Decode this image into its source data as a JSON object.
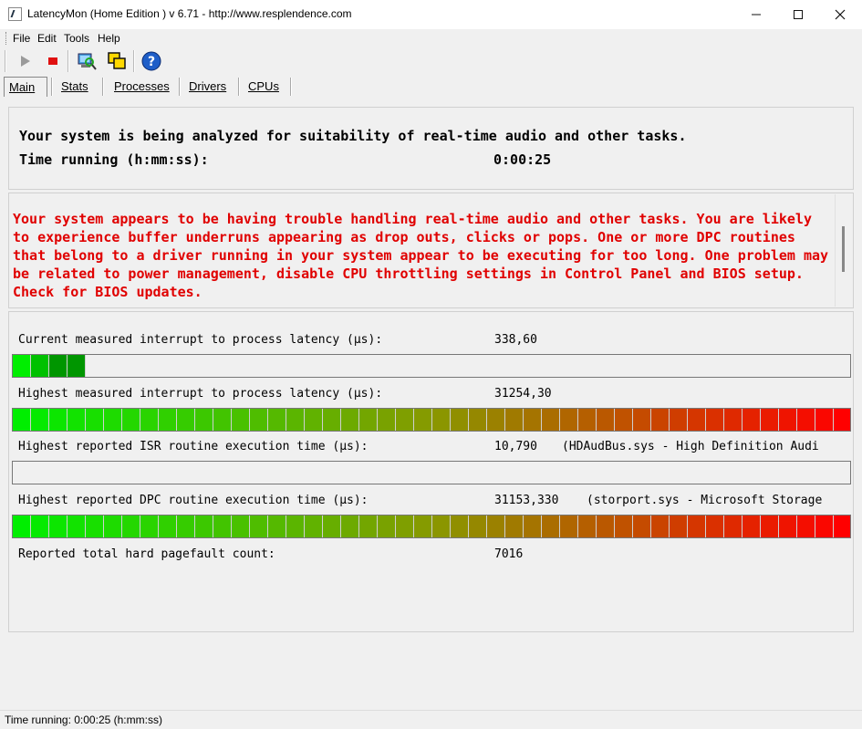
{
  "window": {
    "title": "LatencyMon  (Home Edition )  v 6.71 - http://www.resplendence.com",
    "minimize_icon": "minimize-icon",
    "maximize_icon": "maximize-icon",
    "close_icon": "close-icon"
  },
  "menu": [
    "File",
    "Edit",
    "Tools",
    "Help"
  ],
  "toolbar": {
    "icons": [
      "play-icon",
      "stop-icon",
      "analyze-icon",
      "copy-windows-icon",
      "help-icon"
    ]
  },
  "tabs": [
    "Main",
    "Stats",
    "Processes",
    "Drivers",
    "CPUs"
  ],
  "header": {
    "analyzing": "Your system is being analyzed for suitability of real-time audio and other tasks.",
    "time_label": "Time running (h:mm:ss):",
    "time_value": "0:00:25"
  },
  "conclusion": "Your system appears to be having trouble handling real-time audio and other tasks. You are likely to experience buffer underruns appearing as drop outs, clicks or pops. One or more DPC routines that belong to a driver running in your system appear to be executing for too long. One problem may be related to power management, disable CPU throttling settings in Control Panel and BIOS setup. Check for BIOS updates.",
  "colors": {
    "warning": "#e00000",
    "bar_low": "#00ee00",
    "bar_high": "#ff0000"
  },
  "metrics": [
    {
      "label": "Current measured interrupt to process latency (µs):",
      "value": "338,60",
      "extra": "",
      "bar_fraction": 0.09
    },
    {
      "label": "Highest measured interrupt to process latency (µs):",
      "value": "31254,30",
      "extra": "",
      "bar_fraction": 1.0
    },
    {
      "label": "Highest reported ISR routine execution time (µs):",
      "value": "10,790",
      "extra": "(HDAudBus.sys - High Definition Audi",
      "bar_fraction": 0.0
    },
    {
      "label": "Highest reported DPC routine execution time (µs):",
      "value": "31153,330",
      "extra": "(storport.sys - Microsoft Storage",
      "bar_fraction": 1.0
    },
    {
      "label": "Reported total hard pagefault count:",
      "value": "7016",
      "extra": "",
      "bar_fraction": null
    }
  ],
  "status": "Time running: 0:00:25  (h:mm:ss)"
}
